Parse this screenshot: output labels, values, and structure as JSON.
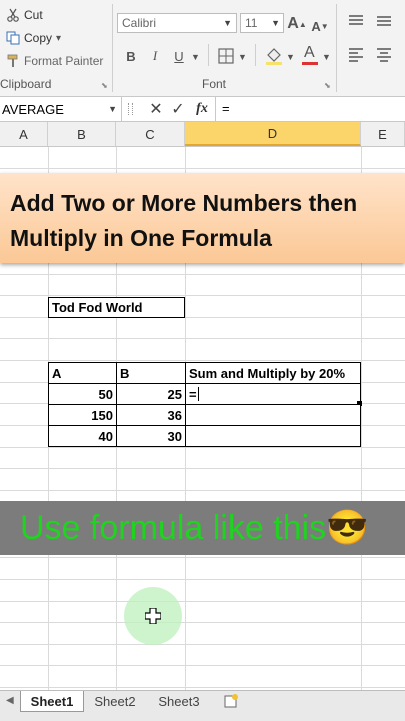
{
  "clipboard": {
    "cut_label": "Cut",
    "copy_label": "Copy",
    "copy_arrow": "▾",
    "format_painter_label": "Format Painter",
    "group_label": "Clipboard"
  },
  "font": {
    "name": "Calibri",
    "size": "11",
    "group_label": "Font",
    "bold": "B",
    "italic": "I",
    "underline": "U",
    "grow": "A",
    "shrink": "A",
    "font_color": "A"
  },
  "formula_bar": {
    "name_box": "AVERAGE",
    "formula": "=",
    "fx_label": "fx"
  },
  "columns": [
    "A",
    "B",
    "C",
    "D",
    "E"
  ],
  "banner": {
    "line1": "Add Two or More Numbers then",
    "line2": "Multiply in One Formula"
  },
  "title_cell": "Tod Fod World",
  "table": {
    "headers": [
      "A",
      "B",
      "Sum and Multiply by 20%"
    ],
    "rows": [
      {
        "a": "50",
        "b": "25",
        "c": "="
      },
      {
        "a": "150",
        "b": "36",
        "c": ""
      },
      {
        "a": "40",
        "b": "30",
        "c": ""
      }
    ]
  },
  "caption": {
    "text": "Use formula like this",
    "emoji": "😎"
  },
  "sheets": [
    "Sheet1",
    "Sheet2",
    "Sheet3"
  ],
  "colors": {
    "caption_green": "#1fd41f",
    "banner_orange": "#fbc896",
    "selected_column": "#fbd46a"
  }
}
